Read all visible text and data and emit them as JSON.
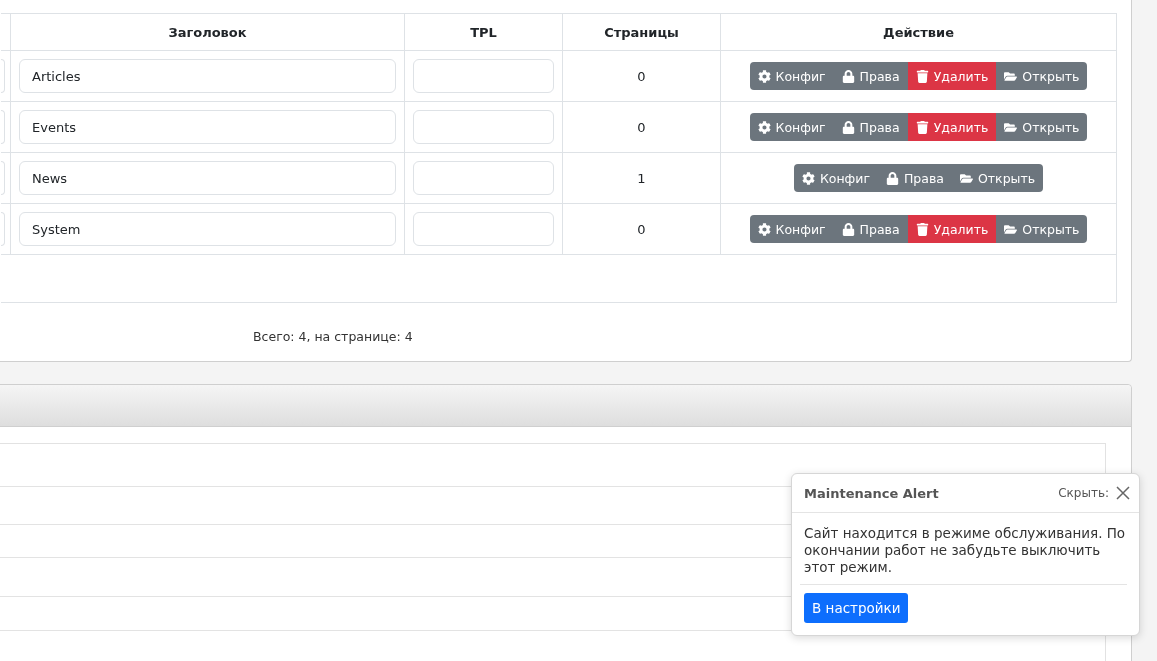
{
  "table": {
    "columns": [
      "Заголовок",
      "TPL",
      "Страницы",
      "Действие"
    ],
    "rows": [
      {
        "title": "Articles",
        "pages": "0",
        "actions": [
          {
            "kind": "config",
            "label": "Конфиг"
          },
          {
            "kind": "rights",
            "label": "Права"
          },
          {
            "kind": "delete",
            "label": "Удалить"
          },
          {
            "kind": "open",
            "label": "Открыть"
          }
        ]
      },
      {
        "title": "Events",
        "pages": "0",
        "actions": [
          {
            "kind": "config",
            "label": "Конфиг"
          },
          {
            "kind": "rights",
            "label": "Права"
          },
          {
            "kind": "delete",
            "label": "Удалить"
          },
          {
            "kind": "open",
            "label": "Открыть"
          }
        ]
      },
      {
        "title": "News",
        "pages": "1",
        "actions": [
          {
            "kind": "config",
            "label": "Конфиг"
          },
          {
            "kind": "rights",
            "label": "Права"
          },
          {
            "kind": "open",
            "label": "Открыть"
          }
        ]
      },
      {
        "title": "System",
        "pages": "0",
        "actions": [
          {
            "kind": "config",
            "label": "Конфиг"
          },
          {
            "kind": "rights",
            "label": "Права"
          },
          {
            "kind": "delete",
            "label": "Удалить"
          },
          {
            "kind": "open",
            "label": "Открыть"
          }
        ]
      }
    ],
    "summary": "Всего: 4, на странице: 4"
  },
  "alert": {
    "title": "Maintenance Alert",
    "hide_label": "Скрыть:",
    "message": "Сайт находится в режиме обслуживания. По окончании работ не забудьте выключить этот режим.",
    "button": "В настройки"
  }
}
